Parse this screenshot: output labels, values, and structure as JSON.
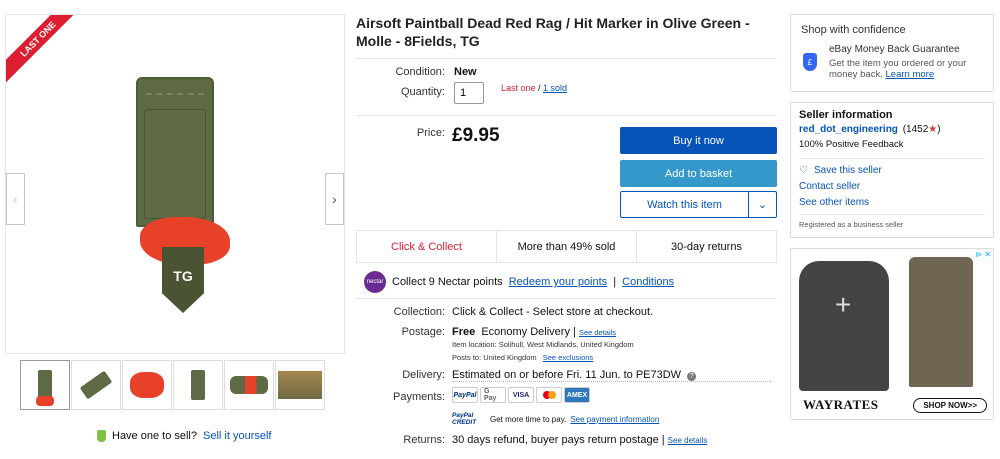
{
  "gallery": {
    "ribbon": "LAST ONE",
    "logo": "TG",
    "prev_icon": "‹",
    "next_icon": "›"
  },
  "sell": {
    "prompt": "Have one to sell?",
    "link": "Sell it yourself"
  },
  "item": {
    "title": "Airsoft Paintball Dead Red Rag / Hit Marker in Olive Green - Molle - 8Fields, TG",
    "condition_label": "Condition:",
    "condition_value": "New",
    "quantity_label": "Quantity:",
    "quantity_value": "1",
    "last_one": "Last one",
    "sold_sep": " / ",
    "sold_link": "1 sold",
    "price_label": "Price:",
    "price": "£9.95"
  },
  "actions": {
    "buy": "Buy it now",
    "basket": "Add to basket",
    "watch": "Watch this item",
    "watch_dropdown_icon": "⌄"
  },
  "features": [
    "Click & Collect",
    "More than 49% sold",
    "30-day returns"
  ],
  "nectar": {
    "icon": "nectar",
    "text": "Collect 9 Nectar points",
    "redeem": "Redeem your points",
    "sep": "|",
    "conditions": "Conditions"
  },
  "collection": {
    "label": "Collection:",
    "value": "Click & Collect - Select store at checkout."
  },
  "postage": {
    "label": "Postage:",
    "free": "Free",
    "service": "Economy Delivery |",
    "details_link": "See details",
    "location": "Item location:  Solihull, West Midlands, United Kingdom",
    "posts_to": "Posts to:  United Kingdom",
    "exclusions_link": "See exclusions"
  },
  "delivery": {
    "label": "Delivery:",
    "value": "Estimated on or before Fri. 11 Jun. to PE73DW",
    "info_icon": "?"
  },
  "payments": {
    "label": "Payments:",
    "methods": [
      "PayPal",
      "G Pay",
      "VISA",
      "",
      "AMEX"
    ],
    "credit_logo": "PayPal CREDIT",
    "credit_text": "Get more time to pay.",
    "credit_link": "See payment information"
  },
  "returns": {
    "label": "Returns:",
    "value": "30 days refund, buyer pays return postage |",
    "details_link": "See details"
  },
  "confidence": {
    "title": "Shop with confidence",
    "guarantee": "eBay Money Back Guarantee",
    "desc": "Get the item you ordered or your money back.",
    "learn": "Learn more",
    "shield_icon": "£"
  },
  "seller": {
    "title": "Seller information",
    "name": "red_dot_engineering",
    "score": "(1452",
    "star": "★",
    "close": ")",
    "feedback": "100% Positive Feedback",
    "save": "Save this seller",
    "contact": "Contact seller",
    "other": "See other items",
    "registered": "Registered as a business seller"
  },
  "ad": {
    "brand": "WAYRATES",
    "cta": "SHOP NOW>>",
    "badge": "⊳ ✕"
  },
  "colors": {
    "link": "#0654ba",
    "buy": "#0654ba",
    "basket": "#3498ca",
    "alert": "#dd1e31"
  }
}
